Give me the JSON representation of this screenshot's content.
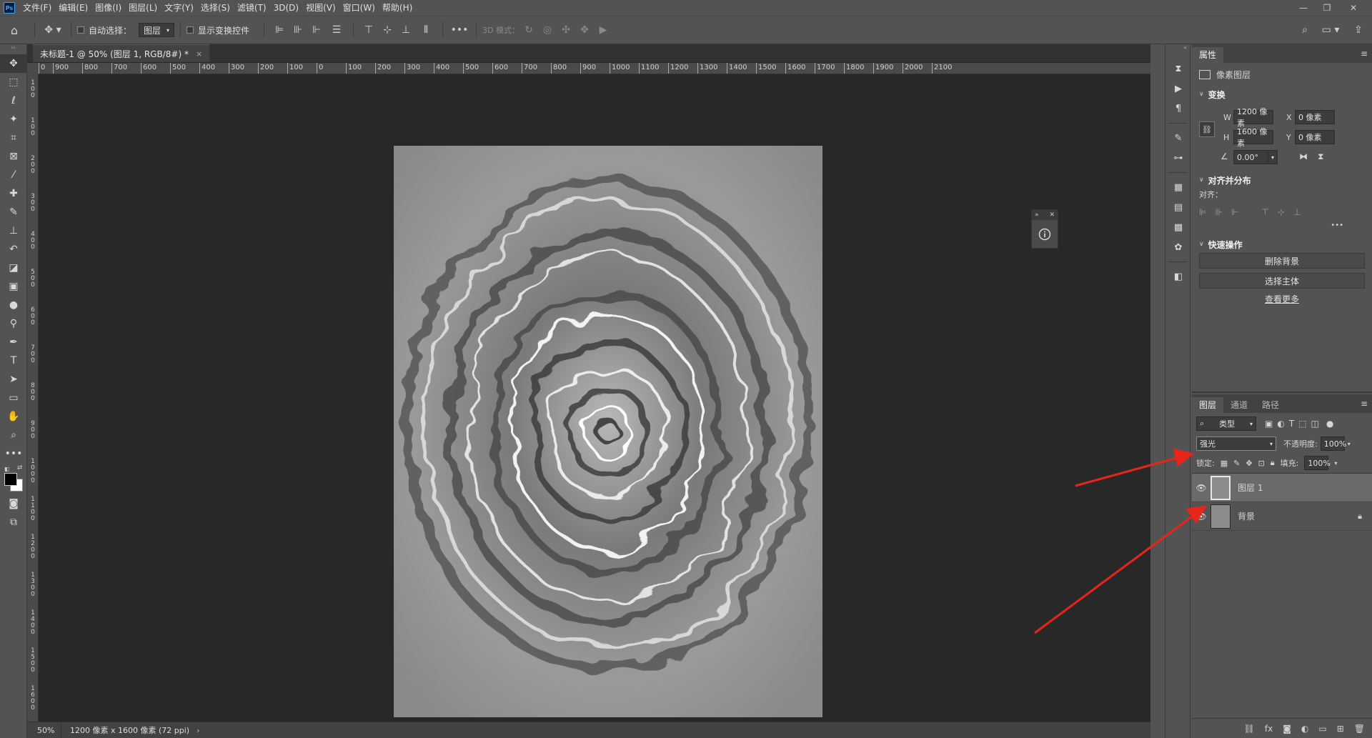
{
  "app": {
    "logo_text": "Ps"
  },
  "menubar": {
    "items": [
      "文件(F)",
      "编辑(E)",
      "图像(I)",
      "图层(L)",
      "文字(Y)",
      "选择(S)",
      "滤镜(T)",
      "3D(D)",
      "视图(V)",
      "窗口(W)",
      "帮助(H)"
    ],
    "window_controls": [
      "—",
      "❐",
      "✕"
    ]
  },
  "options": {
    "auto_select_label": "自动选择：",
    "auto_select_value": "图层",
    "show_transform_label": "显示变换控件",
    "three_d_mode_label": "3D 模式："
  },
  "document": {
    "tab_title": "未标题-1 @ 50% (图层 1, RGB/8#) *",
    "tab_close": "×",
    "ruler_h_labels": [
      "0",
      "900",
      "800",
      "700",
      "600",
      "500",
      "400",
      "300",
      "200",
      "100",
      "0",
      "100",
      "200",
      "300",
      "400",
      "500",
      "600",
      "700",
      "800",
      "900",
      "1000",
      "1100",
      "1200",
      "1300",
      "1400",
      "1500",
      "1600",
      "1700",
      "1800",
      "1900",
      "2000",
      "2100"
    ],
    "ruler_v_labels": [
      "1\n0\n0",
      "1\n0\n0",
      "2\n0\n0",
      "3\n0\n0",
      "4\n0\n0",
      "5\n0\n0",
      "6\n0\n0",
      "7\n0\n0",
      "8\n0\n0",
      "9\n0\n0",
      "1\n0\n0\n0",
      "1\n1\n0\n0",
      "1\n2\n0\n0",
      "1\n3\n0\n0",
      "1\n4\n0\n0",
      "1\n5\n0\n0",
      "1\n6\n0\n0"
    ],
    "zoom": "50%",
    "size_info": "1200 像素 x 1600 像素 (72 ppi)",
    "status_arrow": "›"
  },
  "properties": {
    "tab_label": "属性",
    "layer_type": "像素图层",
    "transform_title": "变换",
    "w_label": "W",
    "w_value": "1200 像素",
    "h_label": "H",
    "h_value": "1600 像素",
    "x_label": "X",
    "x_value": "0 像素",
    "y_label": "Y",
    "y_value": "0 像素",
    "angle_value": "0.00°",
    "align_title": "对齐并分布",
    "align_label": "对齐：",
    "more": "•••",
    "quick_title": "快速操作",
    "remove_bg_button": "删除背景",
    "select_subject_button": "选择主体",
    "view_more_link": "查看更多"
  },
  "layers": {
    "tabs": [
      "图层",
      "通道",
      "路径"
    ],
    "filter_kind": "类型",
    "blend_mode": "强光",
    "opacity_label": "不透明度:",
    "opacity_value": "100%",
    "lock_label": "锁定:",
    "fill_label": "填充:",
    "fill_value": "100%",
    "items": [
      {
        "name": "图层 1",
        "selected": true,
        "locked": false
      },
      {
        "name": "背景",
        "selected": false,
        "locked": true
      }
    ]
  },
  "colors": {
    "annotation_arrow": "#e8251a",
    "panel_bg": "#535353",
    "canvas_bg": "#282828"
  }
}
